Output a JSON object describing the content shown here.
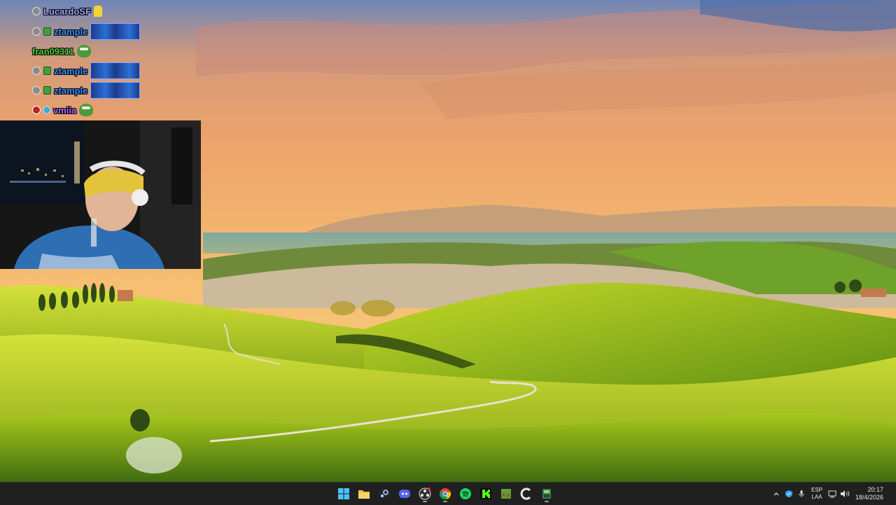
{
  "chat": {
    "messages": [
      {
        "user": "LucardoSF",
        "emote": "pika"
      },
      {
        "user": "ztample",
        "emote": "ships"
      },
      {
        "user": "fran09311",
        "emote": "frog"
      },
      {
        "user": "ztample",
        "emote": "ships"
      },
      {
        "user": "ztample",
        "emote": "ships"
      },
      {
        "user": "vmiia",
        "emote": "frog"
      }
    ]
  },
  "taskbar": {
    "apps": [
      {
        "name": "start-icon",
        "running": false
      },
      {
        "name": "file-explorer-icon",
        "running": false
      },
      {
        "name": "steam-icon",
        "running": false
      },
      {
        "name": "discord-icon",
        "running": false
      },
      {
        "name": "obs-icon",
        "running": true
      },
      {
        "name": "chrome-icon",
        "running": true
      },
      {
        "name": "spotify-icon",
        "running": false
      },
      {
        "name": "kick-icon",
        "running": false
      },
      {
        "name": "minecraft-icon",
        "running": false
      },
      {
        "name": "ccleaner-icon",
        "running": false
      },
      {
        "name": "game-launcher-icon",
        "running": true
      }
    ],
    "tray": {
      "language_top": "ESP",
      "language_bottom": "LAA",
      "time": "20:17",
      "date": "18/4/2026"
    }
  },
  "colors": {
    "taskbar": "#202020",
    "sky_top": "#f2b46a",
    "sky_bottom": "#f7c77a",
    "grass": "#c4d619"
  }
}
